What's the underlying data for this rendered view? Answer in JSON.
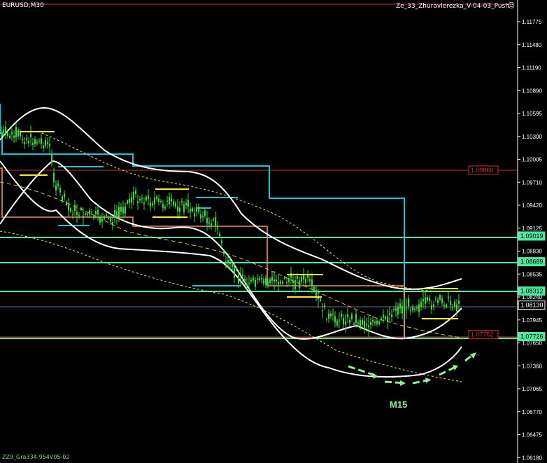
{
  "symbol": "EURUSD,M30",
  "indicator_label": "Ze_33_Zhuravlerezka_V-04-03_Push",
  "smiley_icon": "smiley-icon",
  "footer_text": "ZZ9_Gra334-954V05-02",
  "annotation": "M15",
  "colors": {
    "background": "#000000",
    "candle": "#35e035",
    "band": "#ffffff",
    "level_green": "#4fe8a0",
    "level_red": "#c83232",
    "cyan_line": "#1cc4d8",
    "orange_line": "#f0905a",
    "yellow": "#ffea3c",
    "arrow": "#8ef08e",
    "axis": "#ffffff"
  },
  "chart_data": {
    "type": "candlestick",
    "y_ticks": [
      "1.11775",
      "1.11480",
      "1.11190",
      "1.10890",
      "1.10595",
      "1.10300",
      "1.10005",
      "1.09710",
      "1.09420",
      "1.09125",
      "1.08830",
      "1.08535",
      "1.08240",
      "1.07945",
      "1.07650",
      "1.07360",
      "1.07065",
      "1.06770",
      "1.06475",
      "1.06180"
    ],
    "price_labels": [
      {
        "text": "1.09866",
        "color": "red",
        "value": 1.09866
      },
      {
        "text": "1.09019",
        "color": "green",
        "value": 1.09019
      },
      {
        "text": "1.08689",
        "color": "green",
        "value": 1.08689
      },
      {
        "text": "1.08312",
        "color": "green",
        "value": 1.08312
      },
      {
        "text": "1.08130",
        "color": "white",
        "value": 1.0813
      },
      {
        "text": "1.07752",
        "color": "red",
        "value": 1.07752
      },
      {
        "text": "1.07726",
        "color": "green",
        "value": 1.07726
      }
    ],
    "ylim": [
      1.0618,
      1.1198
    ]
  }
}
